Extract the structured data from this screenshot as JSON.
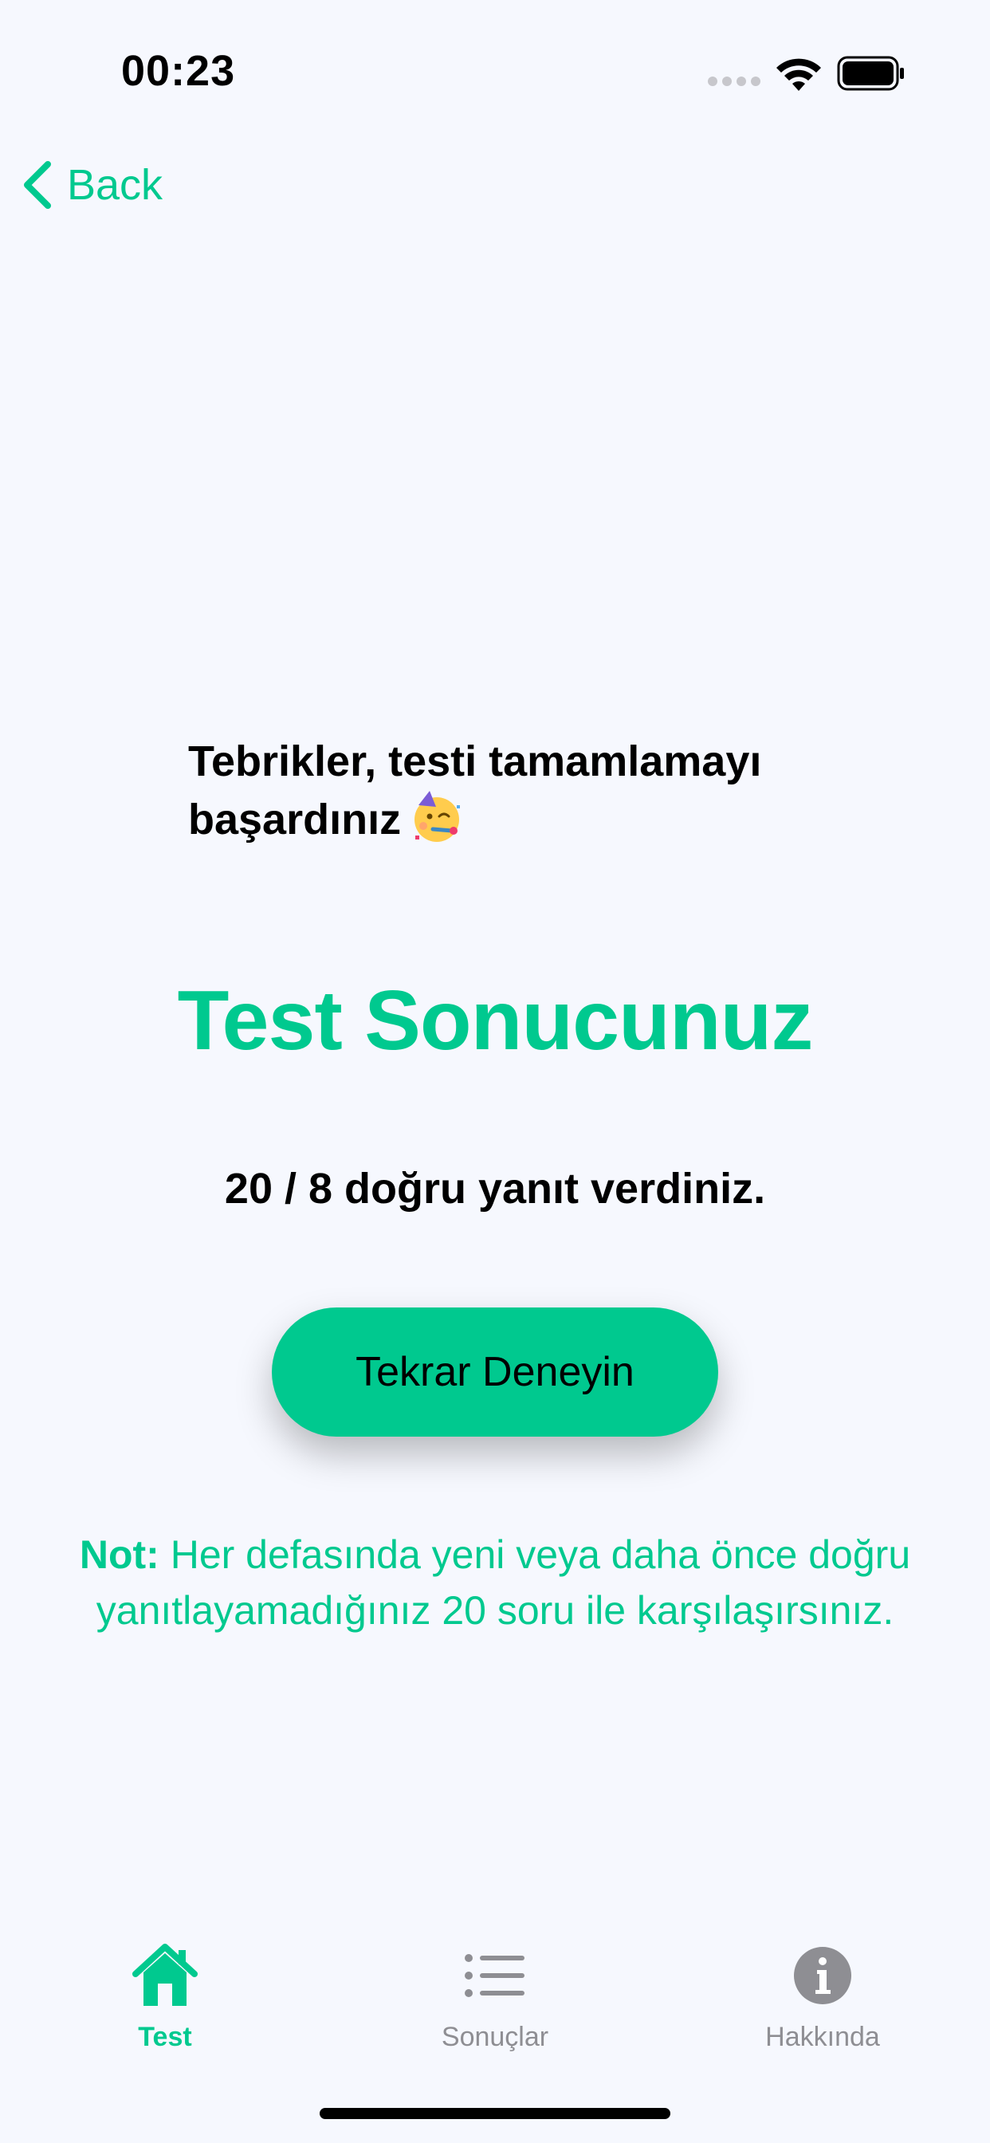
{
  "status_bar": {
    "time": "00:23"
  },
  "nav": {
    "back_label": "Back"
  },
  "result": {
    "congrats": "Tebrikler, testi tamamlamayı başardınız",
    "title": "Test Sonucunuz",
    "score": "20 / 8 doğru yanıt verdiniz.",
    "retry_label": "Tekrar Deneyin",
    "note_prefix": "Not:",
    "note_text": " Her defasında yeni veya daha önce doğru yanıtlayamadığınız 20 soru ile karşılaşırsınız."
  },
  "tabs": [
    {
      "label": "Test",
      "icon": "house-icon",
      "active": true
    },
    {
      "label": "Sonuçlar",
      "icon": "list-icon",
      "active": false
    },
    {
      "label": "Hakkında",
      "icon": "info-icon",
      "active": false
    }
  ],
  "colors": {
    "accent": "#00c98f",
    "background": "#f6f8fe",
    "inactive": "#8e8e93"
  }
}
